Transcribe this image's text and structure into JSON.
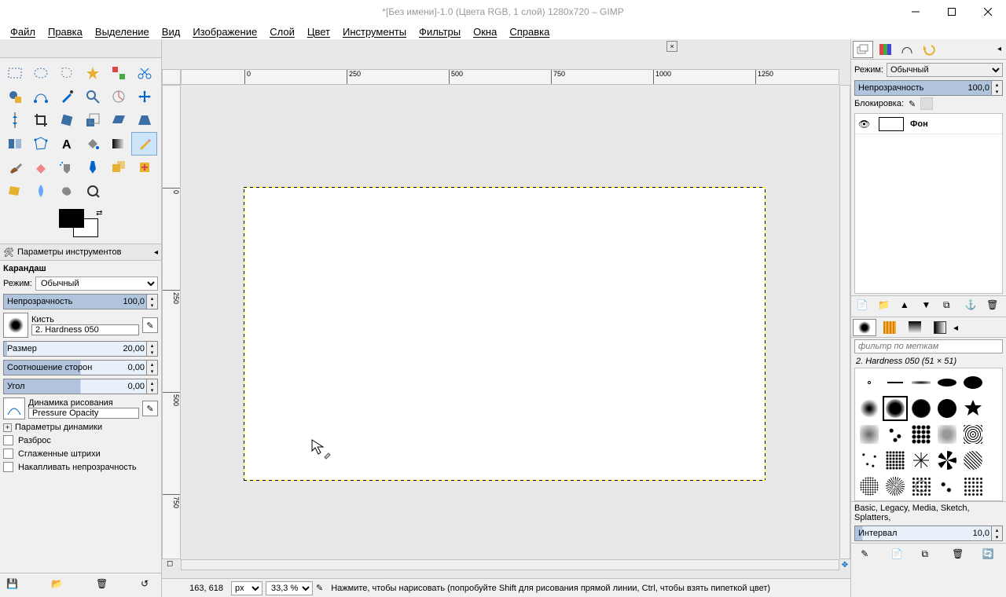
{
  "title": "*[Без имени]-1.0 (Цвета RGB, 1 слой) 1280x720 – GIMP",
  "menu": [
    "Файл",
    "Правка",
    "Выделение",
    "Вид",
    "Изображение",
    "Слой",
    "Цвет",
    "Инструменты",
    "Фильтры",
    "Окна",
    "Справка"
  ],
  "tool_options": {
    "header": "Параметры инструментов",
    "tool_name": "Карандаш",
    "mode_label": "Режим:",
    "mode_value": "Обычный",
    "opacity_label": "Непрозрачность",
    "opacity_value": "100,0",
    "brush_label": "Кисть",
    "brush_name": "2. Hardness 050",
    "size_label": "Размер",
    "size_value": "20,00",
    "aspect_label": "Соотношение сторон",
    "aspect_value": "0,00",
    "angle_label": "Угол",
    "angle_value": "0,00",
    "dynamics_label": "Динамика рисования",
    "dynamics_value": "Pressure Opacity",
    "dynamics_params": "Параметры динамики",
    "scatter": "Разброс",
    "smooth": "Сглаженные штрихи",
    "incremental": "Накапливать непрозрачность"
  },
  "statusbar": {
    "coords": "163, 618",
    "unit": "px",
    "zoom": "33,3 %",
    "hint": "Нажмите, чтобы нарисовать (попробуйте Shift для рисования прямой линии, Ctrl, чтобы взять пипеткой цвет)"
  },
  "layers": {
    "mode_label": "Режим:",
    "mode_value": "Обычный",
    "opacity_label": "Непрозрачность",
    "opacity_value": "100,0",
    "lock_label": "Блокировка:",
    "layer_name": "Фон"
  },
  "brushes": {
    "filter_placeholder": "фильтр по меткам",
    "current": "2. Hardness 050 (51 × 51)",
    "categories": "Basic, Legacy, Media, Sketch, Splatters,",
    "interval_label": "Интервал",
    "interval_value": "10,0"
  },
  "ruler_h": [
    "0",
    "250",
    "500",
    "750",
    "1000",
    "1250"
  ],
  "ruler_v": [
    "0",
    "250",
    "500",
    "750"
  ]
}
